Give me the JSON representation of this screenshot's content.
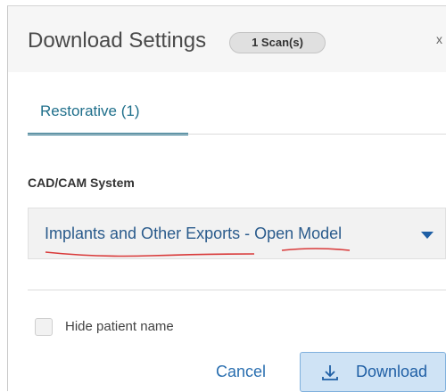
{
  "dialog": {
    "title": "Download Settings",
    "scan_badge": "1 Scan(s)",
    "close_label": "x"
  },
  "tabs": [
    {
      "label": "Restorative (1)",
      "active": true
    }
  ],
  "cadcam": {
    "label": "CAD/CAM System",
    "selected_value": "Implants and Other Exports - Open Model"
  },
  "options": {
    "hide_patient_name_label": "Hide patient name",
    "hide_patient_name_checked": false
  },
  "footer": {
    "cancel_label": "Cancel",
    "download_label": "Download"
  },
  "icons": {
    "caret": "chevron-down-icon",
    "download": "download-icon"
  },
  "colors": {
    "accent": "#1f6f8b",
    "link": "#2a6fb0",
    "download_bg": "#cfe3f5",
    "annotation": "#d93a3a"
  }
}
